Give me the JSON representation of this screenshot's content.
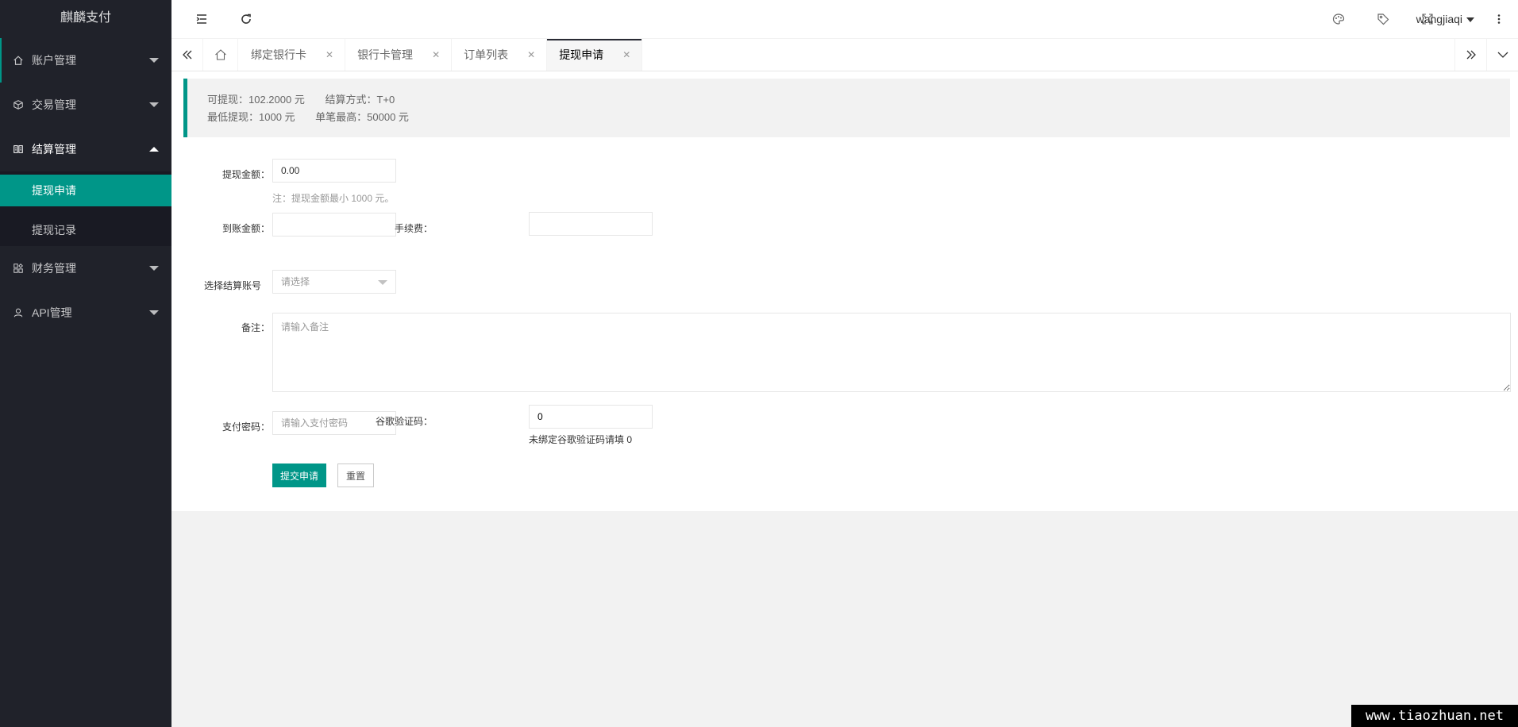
{
  "app": {
    "logo": "麒麟支付"
  },
  "sidebar": {
    "items": [
      {
        "label": "账户管理",
        "icon": "home-icon"
      },
      {
        "label": "交易管理",
        "icon": "cube-icon"
      },
      {
        "label": "结算管理",
        "icon": "settlement-icon",
        "expanded": true,
        "children": [
          {
            "label": "提现申请",
            "selected": true
          },
          {
            "label": "提现记录"
          }
        ]
      },
      {
        "label": "财务管理",
        "icon": "apps-icon"
      },
      {
        "label": "API管理",
        "icon": "user-icon"
      }
    ]
  },
  "header": {
    "icons": [
      "menu-fold-icon",
      "refresh-icon",
      "theme-icon",
      "note-icon",
      "fullscreen-icon",
      "more-icon"
    ],
    "username": "wangjiaqi"
  },
  "tabs": {
    "items": [
      {
        "label": "绑定银行卡"
      },
      {
        "label": "银行卡管理"
      },
      {
        "label": "订单列表"
      },
      {
        "label": "提现申请",
        "active": true
      }
    ],
    "close_glyph": "✕"
  },
  "summary": {
    "available": "可提现：102.2000 元",
    "settle_mode": "结算方式：T+0",
    "min_withdraw": "最低提现：1000 元",
    "max_single": "单笔最高：50000 元"
  },
  "form": {
    "amount_label": "提现金额：",
    "amount_value": "0.00",
    "amount_hint": "注：提现金额最小 1000 元。",
    "arrival_label": "到账金额：",
    "arrival_value": "",
    "fee_label": "手续费：",
    "fee_value": "",
    "account_label": "选择结算账号",
    "account_placeholder": "请选择",
    "remark_label": "备注：",
    "remark_placeholder": "请输入备注",
    "paypwd_label": "支付密码：",
    "paypwd_placeholder": "请输入支付密码",
    "gcode_label": "谷歌验证码：",
    "gcode_value": "0",
    "gcode_hint": "未绑定谷歌验证码请填 0",
    "submit_label": "提交申请",
    "reset_label": "重置"
  },
  "watermark": "www.tiaozhuan.net",
  "colors": {
    "accent": "#009688",
    "sidebar_bg": "#20222a",
    "subnav_bg": "#191a23"
  }
}
